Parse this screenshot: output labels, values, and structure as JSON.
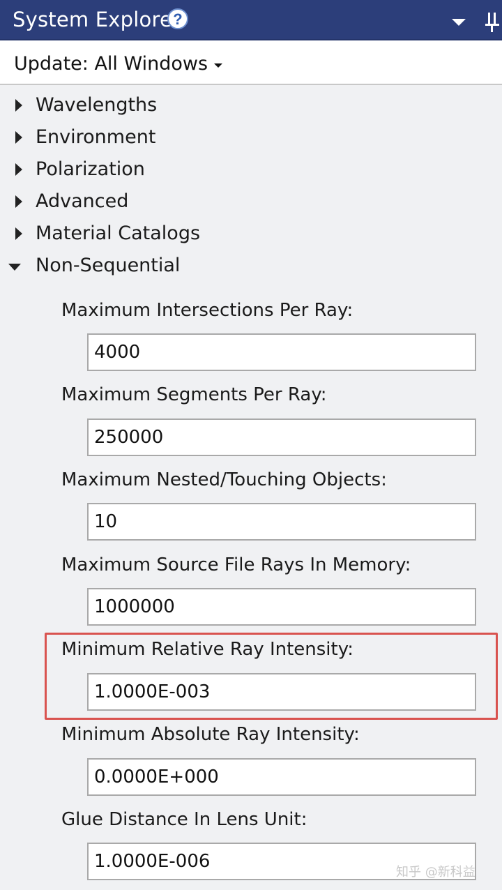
{
  "window": {
    "title": "System Explorer",
    "help_icon": "question-circle-icon",
    "dropdown_icon": "chevron-down-icon",
    "pin_icon": "pin-icon"
  },
  "toolbar": {
    "update_label": "Update: All Windows"
  },
  "tree": {
    "items": [
      {
        "label": "Wavelengths",
        "expanded": false
      },
      {
        "label": "Environment",
        "expanded": false
      },
      {
        "label": "Polarization",
        "expanded": false
      },
      {
        "label": "Advanced",
        "expanded": false
      },
      {
        "label": "Material Catalogs",
        "expanded": false
      },
      {
        "label": "Non-Sequential",
        "expanded": true
      }
    ]
  },
  "non_sequential": {
    "fields": [
      {
        "label": "Maximum Intersections Per Ray:",
        "value": "4000"
      },
      {
        "label": "Maximum Segments Per Ray:",
        "value": "250000"
      },
      {
        "label": "Maximum Nested/Touching Objects:",
        "value": "10"
      },
      {
        "label": "Maximum Source File Rays In Memory:",
        "value": "1000000"
      },
      {
        "label": "Minimum Relative Ray Intensity:",
        "value": "1.0000E-003",
        "highlighted": true
      },
      {
        "label": "Minimum Absolute Ray Intensity:",
        "value": "0.0000E+000"
      },
      {
        "label": "Glue Distance In Lens Unit:",
        "value": "1.0000E-006"
      }
    ]
  },
  "colors": {
    "titlebar": "#2c3e7a",
    "highlight": "#d9534f",
    "panel_bg": "#f0f1f3"
  },
  "watermark": "知乎 @新科益"
}
